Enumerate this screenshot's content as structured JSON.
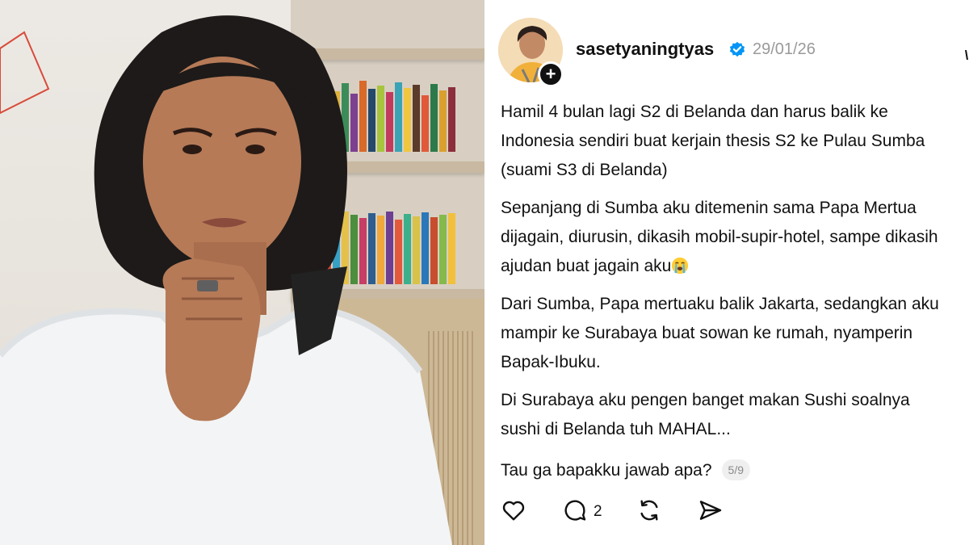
{
  "post": {
    "username": "sasetyaningtyas",
    "date": "29/01/26",
    "paragraphs": [
      [
        "Hamil 4 bulan lagi S2 di Belanda dan harus balik ke",
        "Indonesia sendiri buat kerjain thesis S2 ke Pulau Sumba",
        "(suami S3 di Belanda)"
      ],
      [
        "Sepanjang di Sumba aku ditemenin sama Papa Mertua",
        "dijagain, diurusin, dikasih mobil-supir-hotel, sampe dikasih",
        "ajudan buat jagain aku"
      ],
      [
        "Dari Sumba, Papa mertuaku balik Jakarta, sedangkan aku",
        "mampir ke Surabaya buat sowan ke rumah, nyamperin",
        "Bapak-Ibuku."
      ],
      [
        "Di Surabaya aku pengen banget makan Sushi soalnya",
        "sushi di Belanda tuh MAHAL..."
      ]
    ],
    "last_line": "Tau ga bapakku jawab apa?",
    "page_indicator": "5/9",
    "reply_count": "2"
  },
  "icons": {
    "verified": "verified-badge-icon",
    "emoji": "loudly-crying-face-emoji",
    "like": "heart-icon",
    "reply": "comment-bubble-icon",
    "repost": "repost-icon",
    "share": "send-icon",
    "follow": "plus-icon"
  },
  "colors": {
    "verified": "#0095f6",
    "text": "#111111",
    "muted": "#9a9a9a"
  }
}
